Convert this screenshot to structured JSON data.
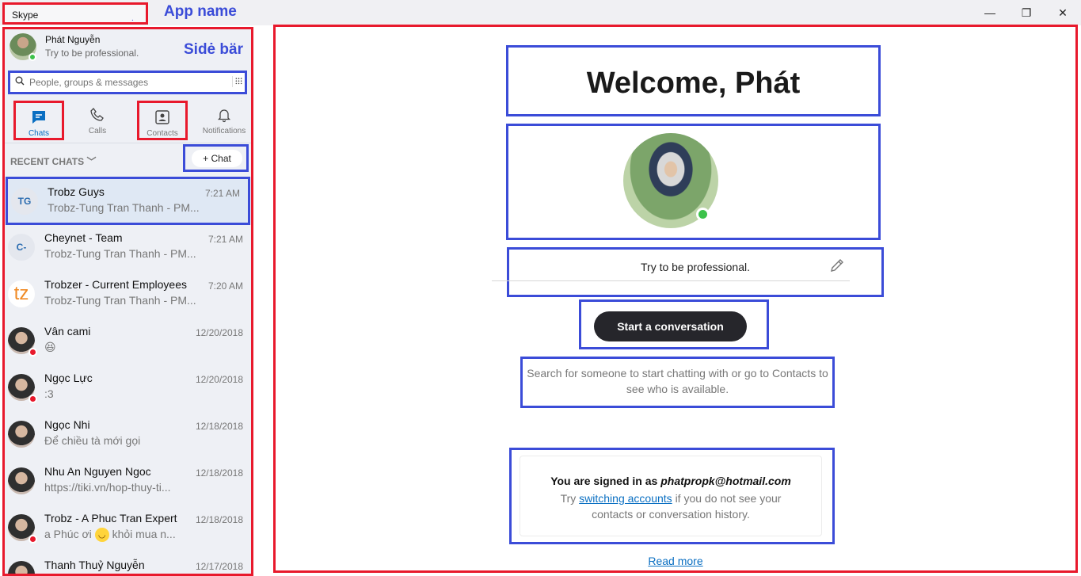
{
  "titlebar": {
    "app_title": "Skype",
    "dot": ".",
    "annotation": "App name",
    "minimize": "—",
    "maximize": "❐",
    "close": "✕"
  },
  "sidebar": {
    "annotation": "Sidė bär",
    "profile": {
      "name": "Phát Nguyễn",
      "mood": "Try to be professional."
    },
    "search": {
      "placeholder": "People, groups & messages"
    },
    "nav": [
      {
        "label": "Chats",
        "icon": "chat-bubble-icon"
      },
      {
        "label": "Calls",
        "icon": "phone-icon"
      },
      {
        "label": "Contacts",
        "icon": "contact-card-icon"
      },
      {
        "label": "Notifications",
        "icon": "bell-icon"
      }
    ],
    "recent_chats_label": "RECENT CHATS",
    "new_chat_label": "Chat",
    "chats": [
      {
        "initials": "TG",
        "name": "Trobz Guys",
        "time": "7:21 AM",
        "preview": "Trobz-Tung Tran Thanh - PM..."
      },
      {
        "initials": "C-",
        "name": "Cheynet - Team",
        "time": "7:21 AM",
        "preview": "Trobz-Tung Tran Thanh - PM..."
      },
      {
        "initials": "tz",
        "name": "Trobzer - Current Employees",
        "time": "7:20 AM",
        "preview": "Trobz-Tung Tran Thanh - PM..."
      },
      {
        "initials": "",
        "name": "Vân cami",
        "time": "12/20/2018",
        "preview": "😆"
      },
      {
        "initials": "",
        "name": "Ngọc Lực",
        "time": "12/20/2018",
        "preview": ":3"
      },
      {
        "initials": "",
        "name": "Ngọc Nhi",
        "time": "12/18/2018",
        "preview": "Để chiều tà mới gọi"
      },
      {
        "initials": "",
        "name": "Nhu An Nguyen Ngoc",
        "time": "12/18/2018",
        "preview": "https://tiki.vn/hop-thuy-ti..."
      },
      {
        "initials": "",
        "name": "Trobz - A Phuc Tran Expert",
        "time": "12/18/2018",
        "preview_before": "a Phúc ơi",
        "preview_after": "khỏi mua n..."
      },
      {
        "initials": "",
        "name": "Thanh Thuỷ Nguyễn",
        "time": "12/17/2018",
        "preview": ""
      }
    ]
  },
  "main": {
    "welcome": "Welcome, Phát",
    "mood": "Try to be professional.",
    "start_button": "Start a conversation",
    "hint": "Search for someone to start chatting with or go to Contacts to see who is available.",
    "signed_in_prefix": "You are signed in as",
    "signed_in_email": "phatpropk@hotmail.com",
    "try_text": "Try",
    "switch_link": "switching accounts",
    "switch_suffix": "if you do not see your contacts or conversation history.",
    "read_more": "Read more"
  },
  "colors": {
    "annotation_red": "#e8192c",
    "annotation_blue": "#3b4cd8",
    "skype_blue": "#0a6fc2",
    "online_green": "#3cc24b"
  }
}
